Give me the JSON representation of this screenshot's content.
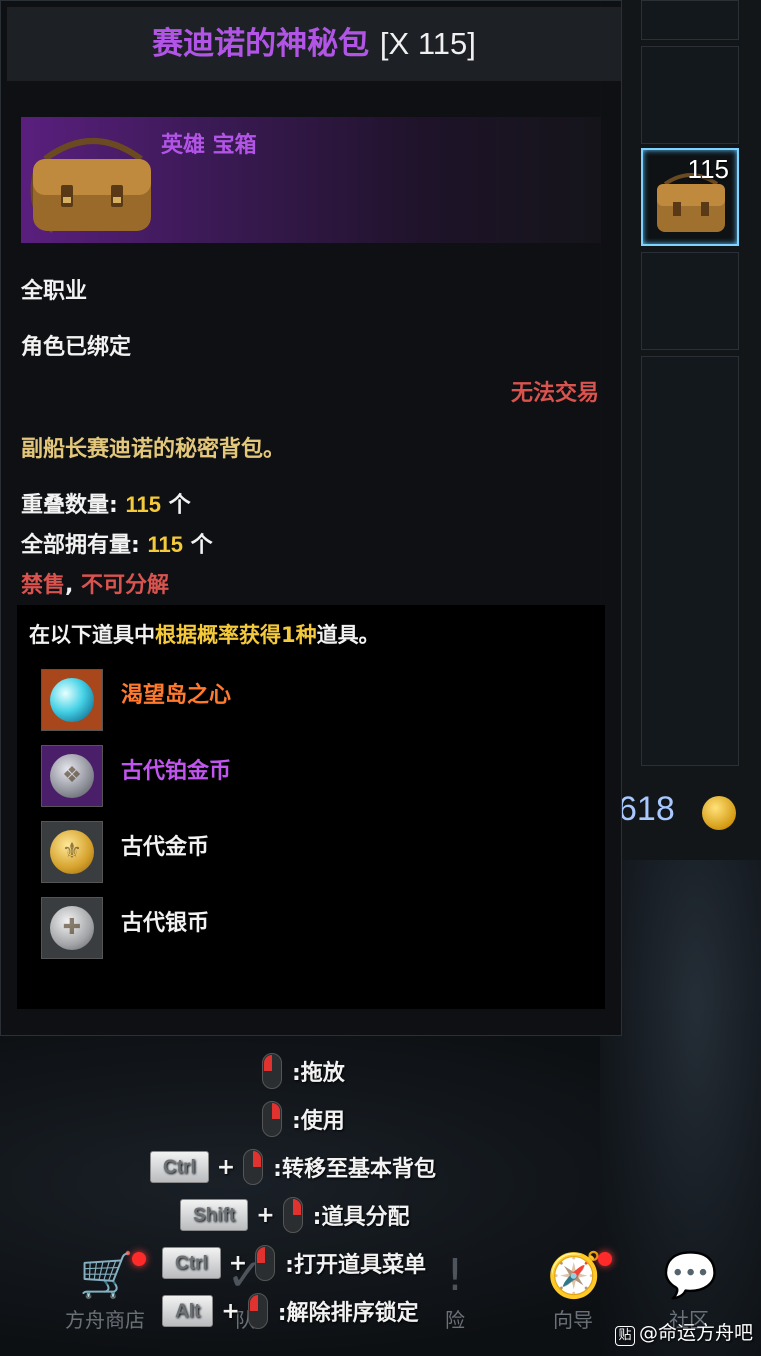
{
  "tooltip": {
    "title": "赛迪诺的神秘包",
    "count": "[X 115]",
    "grade": "英雄 宝箱",
    "class_restriction": "全职业",
    "binding": "角色已绑定",
    "trade_status": "无法交易",
    "description": "副船长赛迪诺的秘密背包。",
    "stack_label": "重叠数量:",
    "stack_value": "115",
    "stack_unit": "个",
    "owned_label": "全部拥有量:",
    "owned_value": "115",
    "owned_unit": "个",
    "restrictions_a": "禁售",
    "restrictions_sep": ",",
    "restrictions_b": "不可分解",
    "rewards": {
      "head_prefix": "在以下道具中",
      "head_highlight": "根据概率获得1种",
      "head_suffix": "道具。",
      "items": [
        {
          "name": "渴望岛之心",
          "color": "#ff7a2e",
          "icon": "gem-icon"
        },
        {
          "name": "古代铂金币",
          "color": "#c255f0",
          "icon": "platinum-coin-icon"
        },
        {
          "name": "古代金币",
          "color": "#f2f2f2",
          "icon": "gold-coin-icon"
        },
        {
          "name": "古代银币",
          "color": "#f2f2f2",
          "icon": "silver-coin-icon"
        }
      ]
    }
  },
  "hints": [
    {
      "keys": [],
      "mouse": "left",
      "label": ":拖放"
    },
    {
      "keys": [],
      "mouse": "right",
      "label": ":使用"
    },
    {
      "keys": [
        "Ctrl"
      ],
      "mouse": "right",
      "label": ":转移至基本背包"
    },
    {
      "keys": [
        "Shift"
      ],
      "mouse": "right",
      "label": ":道具分配"
    },
    {
      "keys": [
        "Ctrl"
      ],
      "mouse": "left",
      "label": ":打开道具菜单"
    },
    {
      "keys": [
        "Alt"
      ],
      "mouse": "left",
      "label": ":解除排序锁定"
    }
  ],
  "inventory": {
    "selected_slot_count": "115",
    "gold_amount": "618"
  },
  "nav": {
    "shop": "方舟商店",
    "team": "队",
    "adventure": "险",
    "guide": "向导",
    "community": "社区"
  },
  "watermark": "@命运方舟吧",
  "watermark_badge": "贴",
  "colors": {
    "hero_purple": "#b255e6",
    "untradable_red": "#d9534f",
    "value_yellow": "#f4c93a",
    "desc_gold": "#e3c77a"
  }
}
